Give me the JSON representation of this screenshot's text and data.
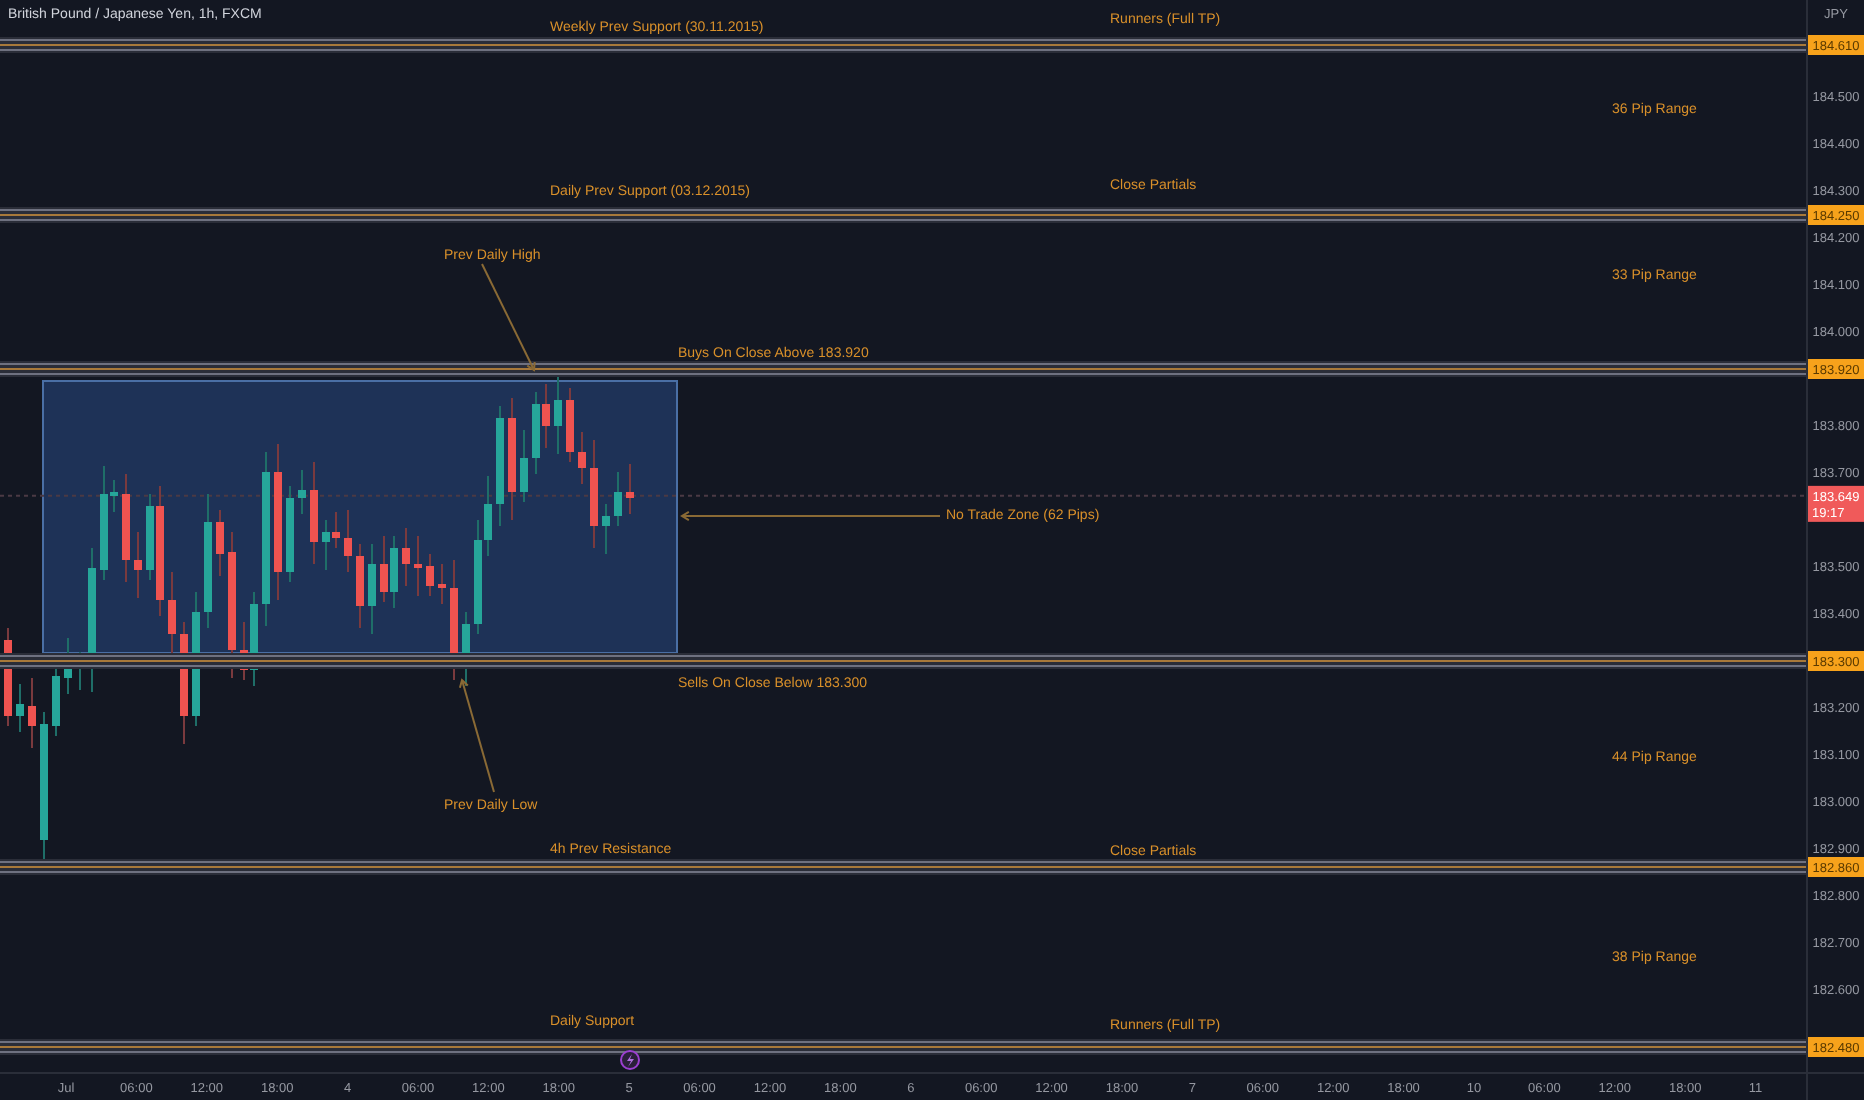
{
  "chart": {
    "title": "British Pound / Japanese Yen, 1h, FXCM",
    "currency": "JPY",
    "price_ticks": [
      "184.500",
      "184.400",
      "184.300",
      "184.200",
      "184.100",
      "184.000",
      "183.800",
      "183.700",
      "183.500",
      "183.400",
      "183.200",
      "183.100",
      "183.000",
      "182.900",
      "182.800",
      "182.700",
      "182.600"
    ],
    "time_ticks": [
      "Jul",
      "06:00",
      "12:00",
      "18:00",
      "4",
      "06:00",
      "12:00",
      "18:00",
      "5",
      "06:00",
      "12:00",
      "18:00",
      "6",
      "06:00",
      "12:00",
      "18:00",
      "7",
      "06:00",
      "12:00",
      "18:00",
      "10",
      "06:00",
      "12:00",
      "18:00",
      "11"
    ],
    "levels": [
      {
        "price": "184.610"
      },
      {
        "price": "184.250"
      },
      {
        "price": "183.920"
      },
      {
        "price": "183.300"
      },
      {
        "price": "182.860"
      },
      {
        "price": "182.480"
      }
    ],
    "annotations": [
      {
        "text": "Weekly Prev Support (30.11.2015)",
        "kind": "label"
      },
      {
        "text": "Runners (Full TP)",
        "kind": "label"
      },
      {
        "text": "36 Pip Range",
        "kind": "label"
      },
      {
        "text": "Daily Prev Support (03.12.2015)",
        "kind": "label"
      },
      {
        "text": "Close Partials",
        "kind": "label"
      },
      {
        "text": "Prev Daily High",
        "kind": "callout"
      },
      {
        "text": "33 Pip Range",
        "kind": "label"
      },
      {
        "text": "Buys On Close Above 183.920",
        "kind": "label"
      },
      {
        "text": "No Trade Zone (62 Pips)",
        "kind": "callout"
      },
      {
        "text": "Sells On Close Below 183.300",
        "kind": "label"
      },
      {
        "text": "44 Pip Range",
        "kind": "label"
      },
      {
        "text": "Prev Daily Low",
        "kind": "callout"
      },
      {
        "text": "4h Prev Resistance",
        "kind": "label"
      },
      {
        "text": "Close Partials",
        "kind": "label"
      },
      {
        "text": "38 Pip Range",
        "kind": "label"
      },
      {
        "text": "Daily Support",
        "kind": "label"
      },
      {
        "text": "Runners (Full TP)",
        "kind": "label"
      }
    ],
    "current_price": {
      "price": "183.649",
      "countdown": "19:17"
    }
  }
}
